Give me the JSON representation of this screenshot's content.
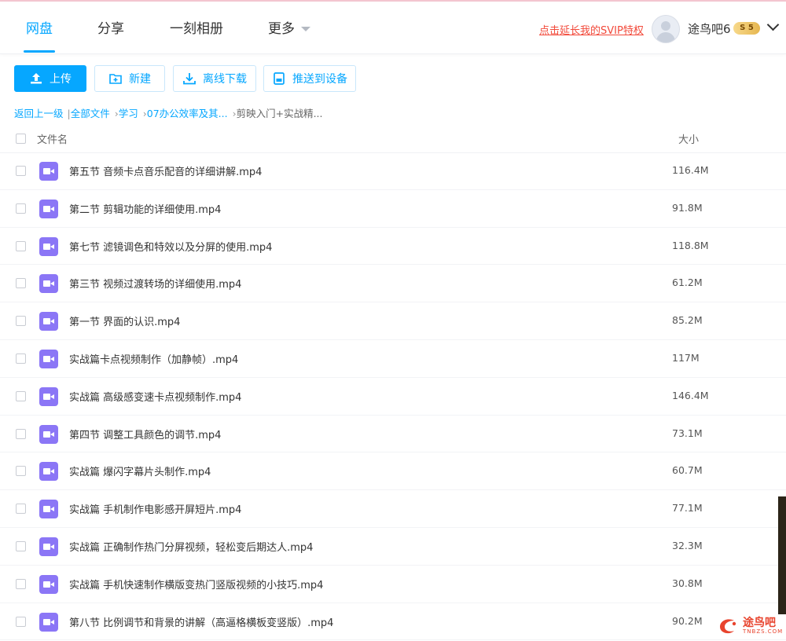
{
  "nav": {
    "tabs": [
      {
        "label": "网盘",
        "active": true
      },
      {
        "label": "分享"
      },
      {
        "label": "一刻相册"
      },
      {
        "label": "更多"
      }
    ]
  },
  "header": {
    "svip_link": "点击延长我的SVIP特权",
    "username": "途鸟吧6",
    "vip_level": "5"
  },
  "toolbar": {
    "upload": "上传",
    "new_folder": "新建",
    "offline_download": "离线下载",
    "push_to_device": "推送到设备"
  },
  "breadcrumb": {
    "back": "返回上一级",
    "items": [
      "全部文件",
      "学习",
      "07办公效率及其...",
      "剪映入门+实战精..."
    ]
  },
  "list": {
    "col_name": "文件名",
    "col_size": "大小",
    "files": [
      {
        "name": "第五节 音频卡点音乐配音的详细讲解.mp4",
        "size": "116.4M"
      },
      {
        "name": "第二节 剪辑功能的详细使用.mp4",
        "size": "91.8M"
      },
      {
        "name": "第七节 滤镜调色和特效以及分屏的使用.mp4",
        "size": "118.8M"
      },
      {
        "name": "第三节 视频过渡转场的详细使用.mp4",
        "size": "61.2M"
      },
      {
        "name": "第一节 界面的认识.mp4",
        "size": "85.2M"
      },
      {
        "name": "实战篇卡点视频制作（加静帧）.mp4",
        "size": "117M"
      },
      {
        "name": "实战篇 高级感变速卡点视频制作.mp4",
        "size": "146.4M"
      },
      {
        "name": "第四节 调整工具颜色的调节.mp4",
        "size": "73.1M"
      },
      {
        "name": "实战篇 爆闪字幕片头制作.mp4",
        "size": "60.7M"
      },
      {
        "name": "实战篇 手机制作电影感开屏短片.mp4",
        "size": "77.1M"
      },
      {
        "name": "实战篇 正确制作热门分屏视频，轻松变后期达人.mp4",
        "size": "32.3M"
      },
      {
        "name": "实战篇 手机快速制作横版变热门竖版视频的小技巧.mp4",
        "size": "30.8M"
      },
      {
        "name": "第八节 比例调节和背景的讲解（高逼格横板变竖版）.mp4",
        "size": "90.2M"
      }
    ]
  },
  "watermark": {
    "text": "途鸟吧",
    "sub": "TNBZS.COM"
  },
  "colors": {
    "accent": "#06a7ff",
    "link_red": "#f2493a",
    "video_icon": "#8b76f6"
  }
}
